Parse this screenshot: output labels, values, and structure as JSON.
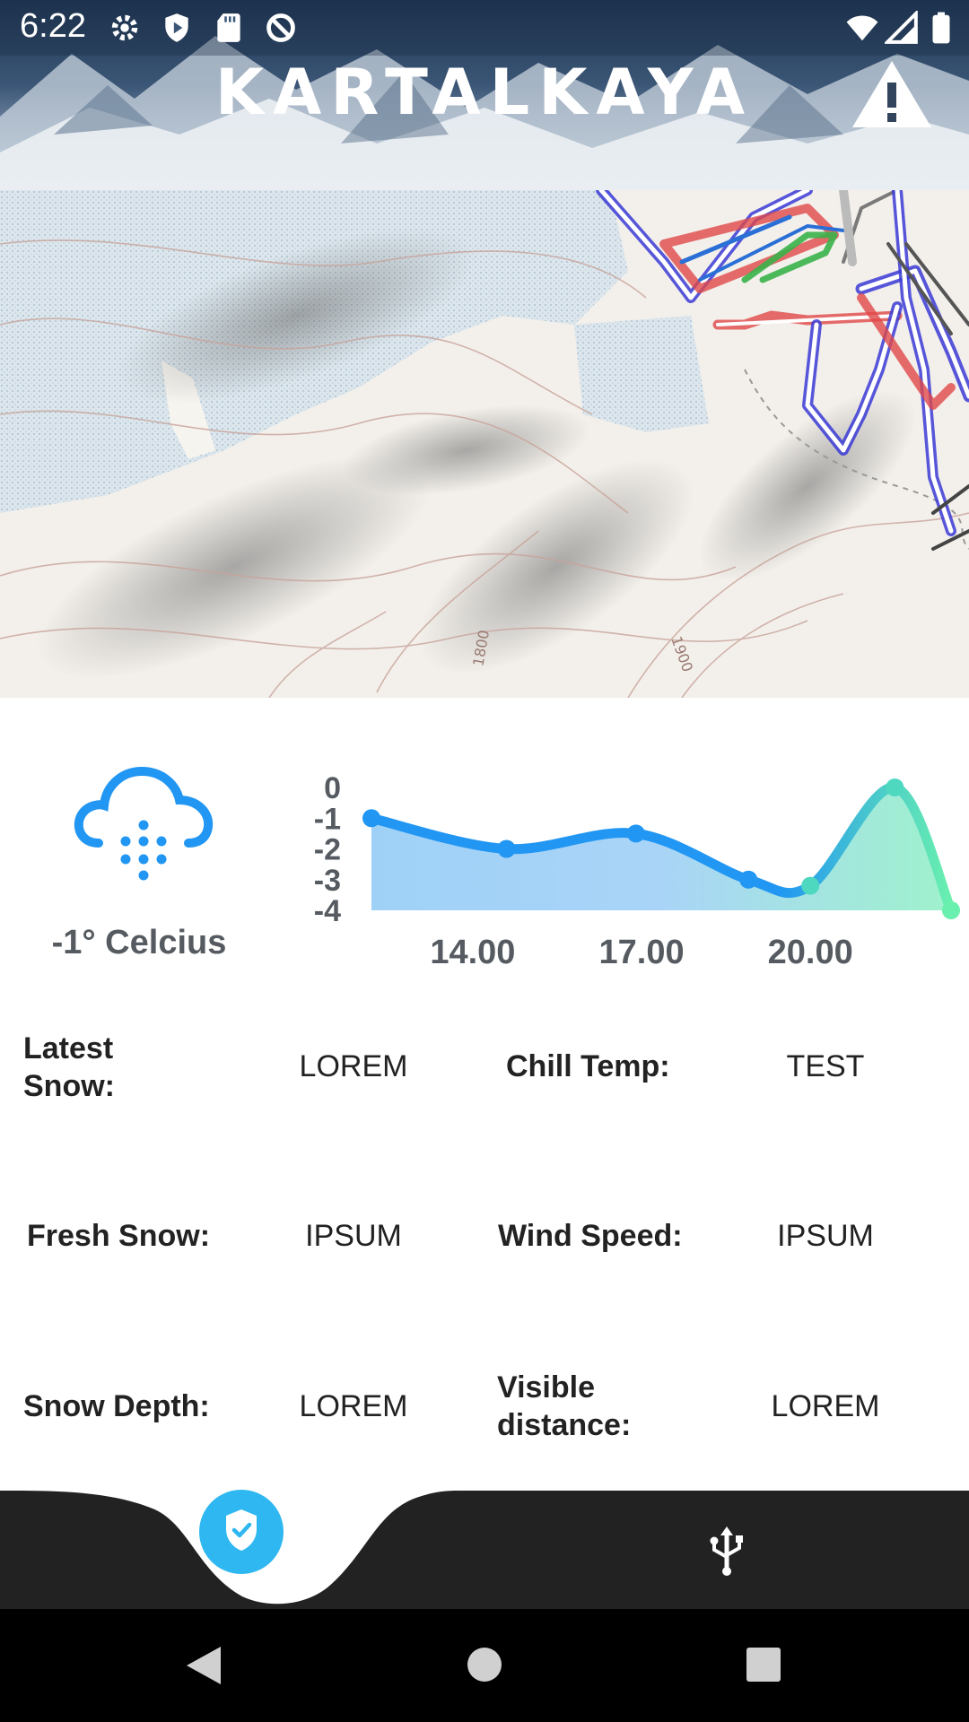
{
  "status_bar": {
    "time": "6:22",
    "icons": [
      "settings-icon",
      "shield-play-icon",
      "sd-card-icon",
      "data-saver-icon",
      "wifi-icon",
      "signal-icon",
      "battery-icon"
    ]
  },
  "header": {
    "title": "KARTALKAYA",
    "alert_icon": "warning-icon"
  },
  "map": {
    "contour_labels": [
      "1800",
      "1900"
    ]
  },
  "weather": {
    "icon": "snow-cloud-icon",
    "temperature": "-1° Celcius"
  },
  "chart_data": {
    "type": "area",
    "x_tick_labels": [
      "14.00",
      "17.00",
      "20.00"
    ],
    "y_tick_labels": [
      "0",
      "-1",
      "-2",
      "-3",
      "-4"
    ],
    "ylim": [
      -4,
      0
    ],
    "points": [
      {
        "x": 12.2,
        "y": -1.0
      },
      {
        "x": 14.6,
        "y": -2.0
      },
      {
        "x": 16.9,
        "y": -1.5
      },
      {
        "x": 18.9,
        "y": -3.0
      },
      {
        "x": 20.0,
        "y": -3.2
      },
      {
        "x": 21.5,
        "y": 0.0
      },
      {
        "x": 22.5,
        "y": -4.0
      }
    ],
    "colors": {
      "start": "#2196f3",
      "end": "#69f0ae"
    }
  },
  "info": {
    "latest_snow": {
      "label": "Latest\nSnow:",
      "value": "LOREM"
    },
    "chill_temp": {
      "label": "Chill Temp:",
      "value": "TEST"
    },
    "fresh_snow": {
      "label": "Fresh Snow:",
      "value": "IPSUM"
    },
    "wind_speed": {
      "label": "Wind Speed:",
      "value": "IPSUM"
    },
    "snow_depth": {
      "label": "Snow Depth:",
      "value": "LOREM"
    },
    "visible_distance": {
      "label": "Visible\ndistance:",
      "value": "LOREM"
    }
  },
  "bottom_nav": {
    "items": [
      "verified-shield-icon",
      "usb-icon"
    ],
    "active_color": "#2eb7f0",
    "bar_color": "#222222"
  },
  "system_nav": [
    "back-icon",
    "home-icon",
    "recents-icon"
  ]
}
